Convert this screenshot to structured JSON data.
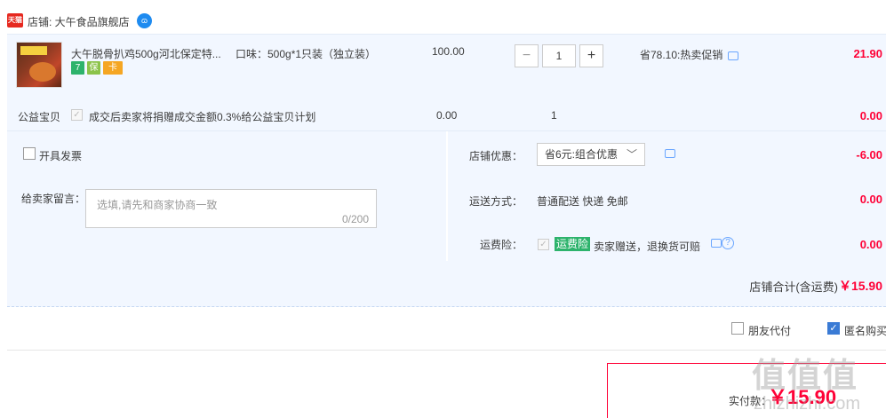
{
  "shop": {
    "badge": "天猫",
    "name": "店铺: 大午食品旗舰店"
  },
  "item": {
    "title": "大午脱骨扒鸡500g河北保定特...",
    "badges": [
      "7",
      "保",
      "卡"
    ],
    "sku": "口味：500g*1只装（独立装）",
    "unit_price": "100.00",
    "quantity": "1",
    "minus": "−",
    "plus": "+",
    "promo": "省78.10:热卖促销",
    "total": "21.90"
  },
  "charity": {
    "label": "公益宝贝",
    "text": "成交后卖家将捐赠成交金额0.3%给公益宝贝计划",
    "price": "0.00",
    "qty": "1",
    "total": "0.00"
  },
  "invoice": {
    "label": "开具发票"
  },
  "message": {
    "label": "给卖家留言：",
    "placeholder": "选填,请先和商家协商一致",
    "counter": "0/200"
  },
  "shop_discount": {
    "label": "店铺优惠：",
    "selected": "省6元:组合优惠",
    "value": "-6.00"
  },
  "shipping": {
    "label": "运送方式：",
    "text": "普通配送 快递 免邮",
    "value": "0.00"
  },
  "insurance": {
    "label": "运费险：",
    "tag": "运费险",
    "text": "卖家赠送，退换货可赔",
    "value": "0.00"
  },
  "shop_total": {
    "label": "店铺合计(含运费)",
    "value": "￥15.90"
  },
  "options": {
    "friend_pay": "朋友代付",
    "anonymous": "匿名购买"
  },
  "payment": {
    "label": "实付款：",
    "value": "￥15.90"
  },
  "watermark": {
    "main": "值值值",
    "sub": "zhizhizhi.com"
  }
}
